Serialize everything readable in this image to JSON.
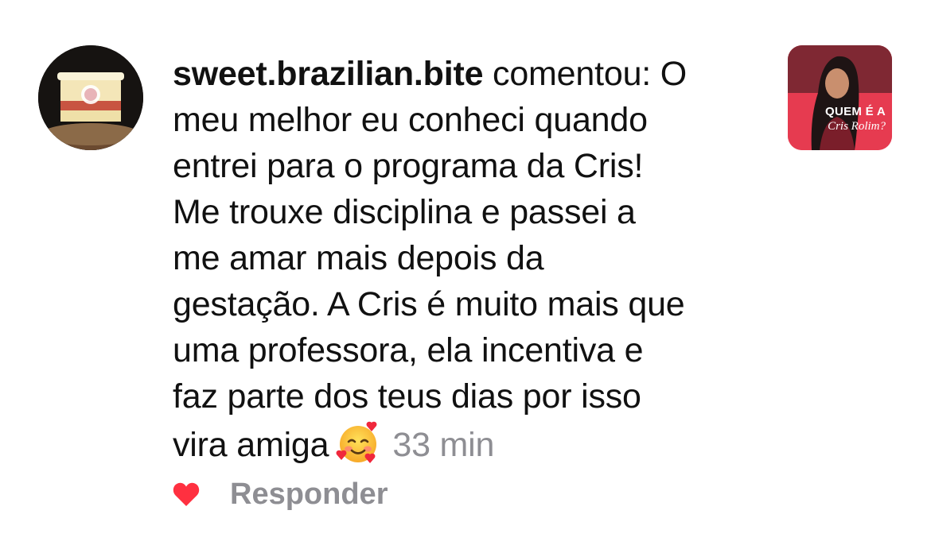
{
  "comment": {
    "username": "sweet.brazilian.bite",
    "verb": " comentou: O",
    "lines": [
      "meu melhor eu conheci quando",
      "entrei para o programa da Cris!",
      "Me trouxe disciplina e passei a",
      "me amar mais depois da",
      "gestação. A Cris é muito mais que",
      "uma professora, ela incentiva e",
      "faz parte dos teus dias por isso",
      "vira amiga"
    ],
    "emoji": "smiling-face-with-hearts",
    "time": "33 min"
  },
  "thumbnail": {
    "title": "QUEM É A",
    "subtitle": "Cris Rolim?",
    "accent": "#e63b50"
  },
  "actions": {
    "like_icon": "heart-icon",
    "like_color": "#ff3040",
    "reply_label": "Responder"
  }
}
